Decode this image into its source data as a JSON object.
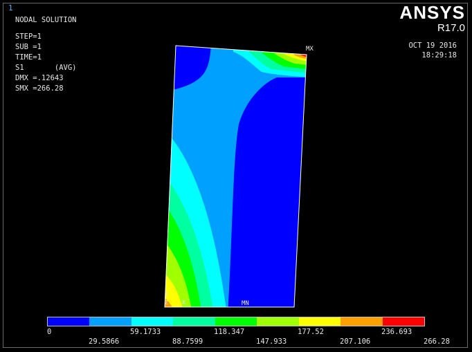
{
  "window_number": "1",
  "brand": {
    "name": "ANSYS",
    "release": "R17.0"
  },
  "info_lines": [
    "NODAL SOLUTION",
    "",
    "STEP=1",
    "SUB =1",
    "TIME=1",
    "S1       (AVG)",
    "DMX =.12643",
    "SMX =266.28"
  ],
  "date": "OCT 19 2016",
  "time": "18:29:18",
  "markers": {
    "max": "MX",
    "min": "MN",
    "axis_x": "X",
    "axis_y": "Y",
    "axis_z": "Z"
  },
  "legend": {
    "colors": [
      "#0000ff",
      "#00a0ff",
      "#00ffff",
      "#00ffa0",
      "#00ff00",
      "#a0ff00",
      "#ffff00",
      "#ffa000",
      "#ff0000"
    ],
    "labels_top": [
      "0",
      "59.1733",
      "118.347",
      "177.52",
      "236.693"
    ],
    "labels_bottom": [
      "29.5866",
      "88.7599",
      "147.933",
      "207.106",
      "266.28"
    ]
  }
}
